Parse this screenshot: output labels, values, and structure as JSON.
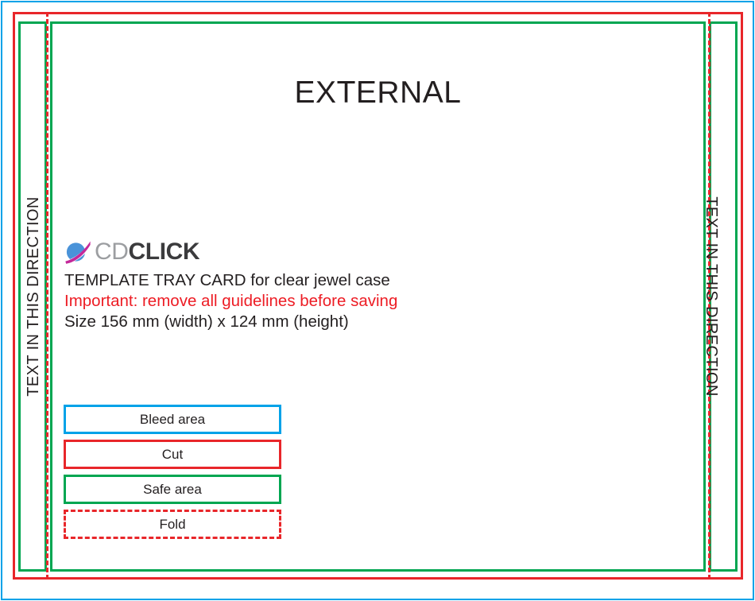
{
  "document": {
    "title": "EXTERNAL"
  },
  "spine": {
    "left_text": "TEXT IN THIS DIRECTION",
    "right_text": "TEXT IN THIS DIRECTION"
  },
  "brand": {
    "logo_icon": "cdclick-sphere-swoosh-icon",
    "name_part1": "CD",
    "name_part2": "CLICK"
  },
  "info": {
    "template_line": "TEMPLATE TRAY CARD for clear jewel case",
    "warning_line": "Important: remove all guidelines before saving",
    "size_line": "Size 156 mm (width) x 124 mm (height)"
  },
  "legend": {
    "items": [
      {
        "label": "Bleed area",
        "color": "#00a2e8",
        "style": "solid"
      },
      {
        "label": "Cut",
        "color": "#e8262a",
        "style": "solid"
      },
      {
        "label": "Safe area",
        "color": "#00a651",
        "style": "solid"
      },
      {
        "label": "Fold",
        "color": "#e8262a",
        "style": "dashed"
      }
    ]
  },
  "guides": {
    "bleed_color": "#00a2e8",
    "cut_color": "#e8262a",
    "safe_color": "#00a651",
    "fold_color": "#e8262a"
  }
}
